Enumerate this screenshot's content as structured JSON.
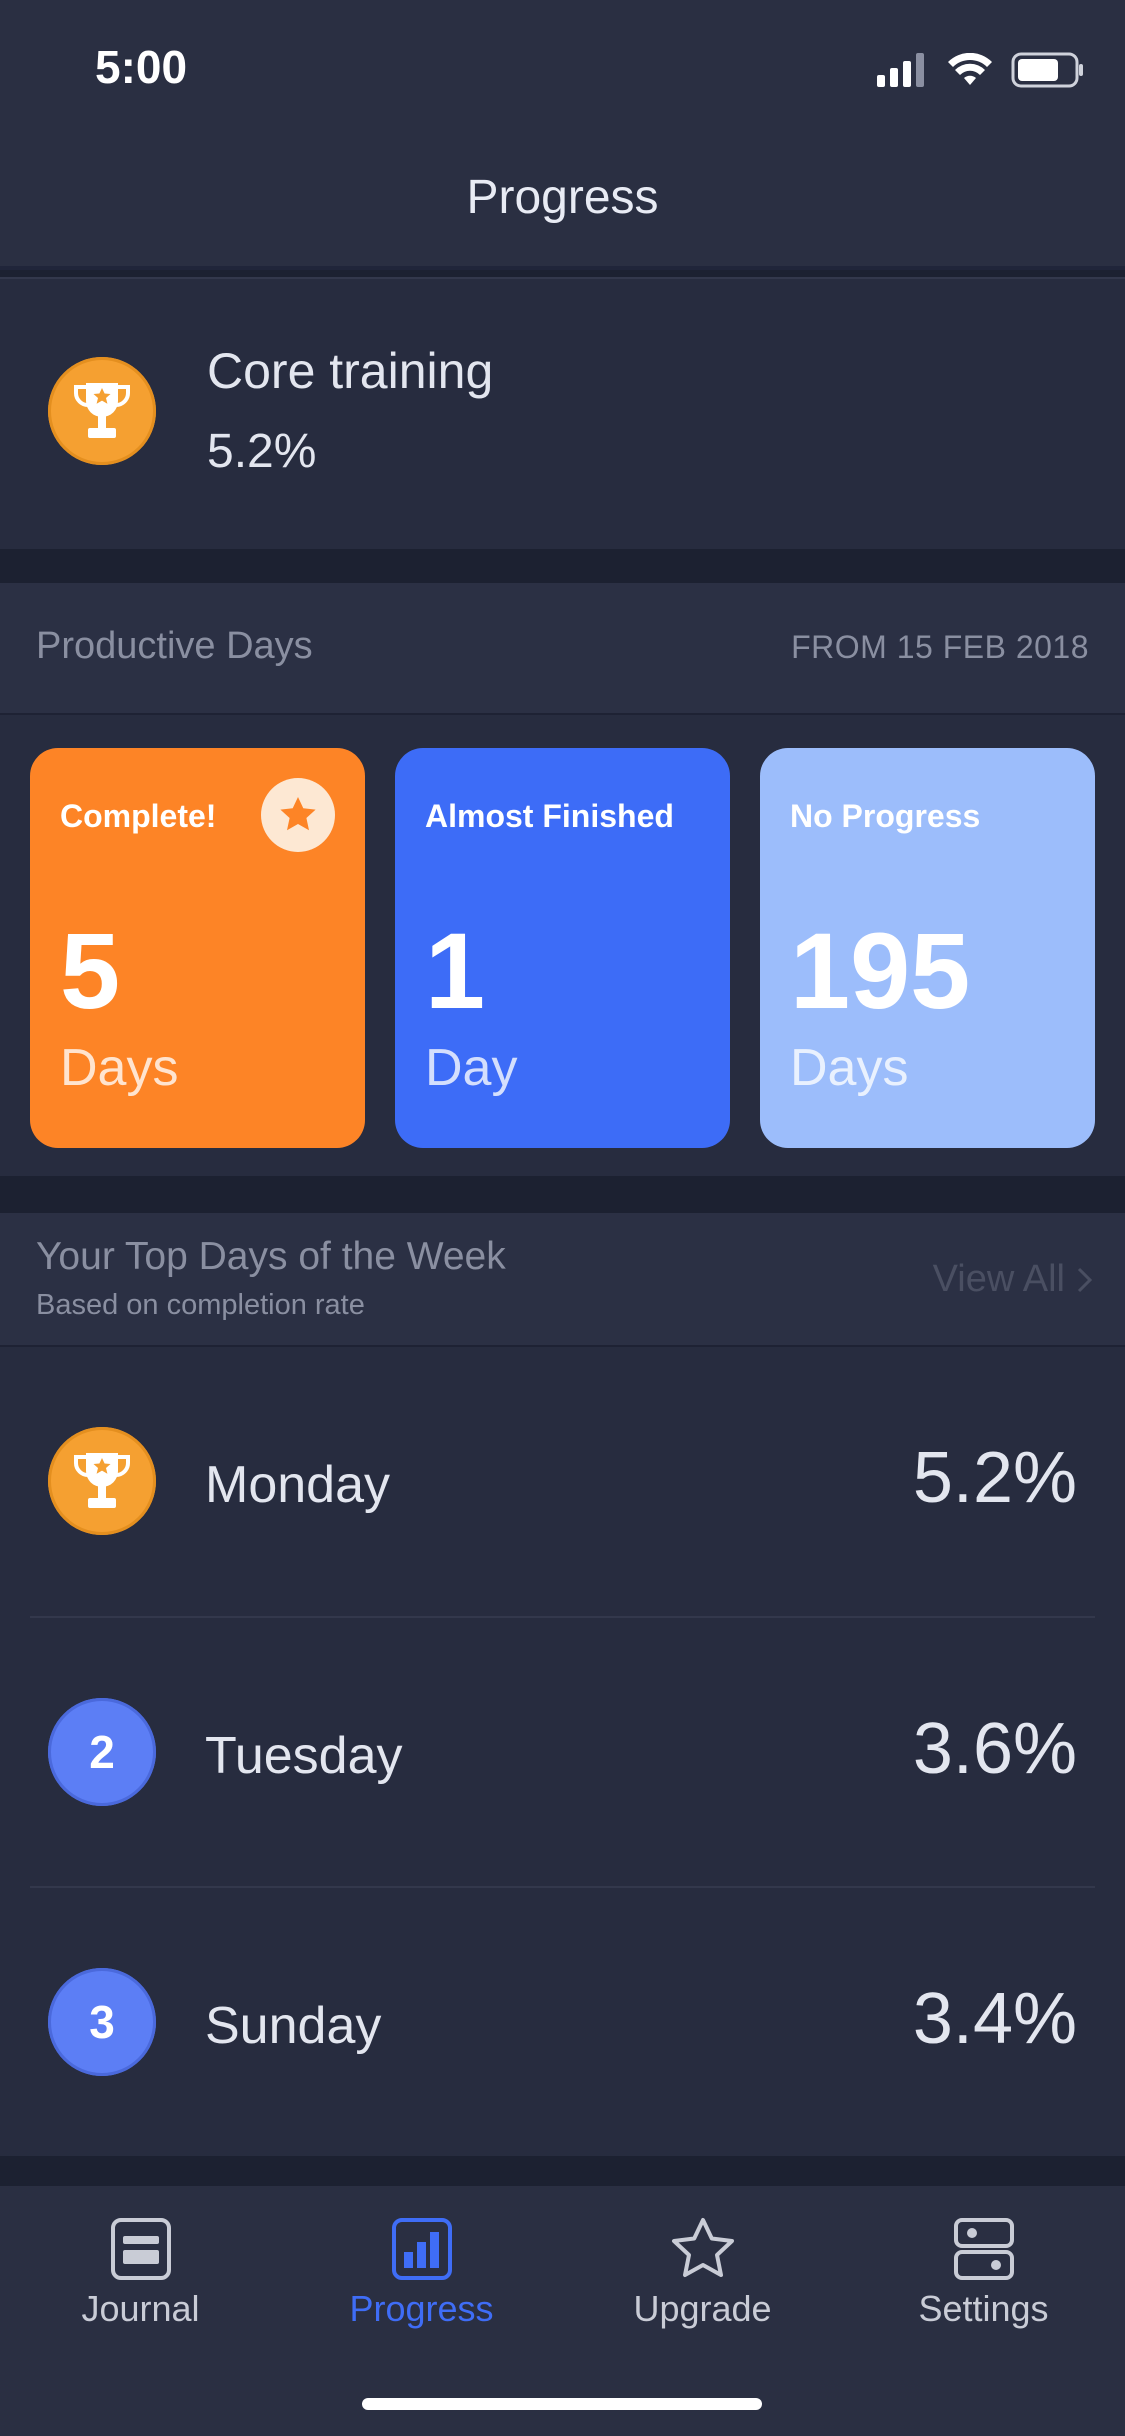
{
  "status_bar": {
    "time": "5:00"
  },
  "header": {
    "title": "Progress"
  },
  "goal": {
    "name": "Core training",
    "percent": "5.2%"
  },
  "productive_days": {
    "title": "Productive Days",
    "since": "FROM 15 FEB 2018",
    "tiles": [
      {
        "label": "Complete!",
        "value": "5",
        "unit": "Days",
        "color": "#fd8426"
      },
      {
        "label": "Almost Finished",
        "value": "1",
        "unit": "Day",
        "color": "#3d6cf7"
      },
      {
        "label": "No Progress",
        "value": "195",
        "unit": "Days",
        "color": "#9cbdfb"
      }
    ]
  },
  "top_days": {
    "title": "Your Top Days of the Week",
    "subtitle": "Based on completion rate",
    "view_all": "View All",
    "rows": [
      {
        "rank": "1",
        "day": "Monday",
        "percent": "5.2%"
      },
      {
        "rank": "2",
        "day": "Tuesday",
        "percent": "3.6%"
      },
      {
        "rank": "3",
        "day": "Sunday",
        "percent": "3.4%"
      }
    ]
  },
  "tabs": [
    {
      "label": "Journal",
      "icon": "journal-icon",
      "active": false
    },
    {
      "label": "Progress",
      "icon": "bar-chart-icon",
      "active": true
    },
    {
      "label": "Upgrade",
      "icon": "star-icon",
      "active": false
    },
    {
      "label": "Settings",
      "icon": "settings-icon",
      "active": false
    }
  ],
  "colors": {
    "accent": "#3f6df6",
    "gold": "#f5a031",
    "rank_blue": "#5c7ef5"
  }
}
